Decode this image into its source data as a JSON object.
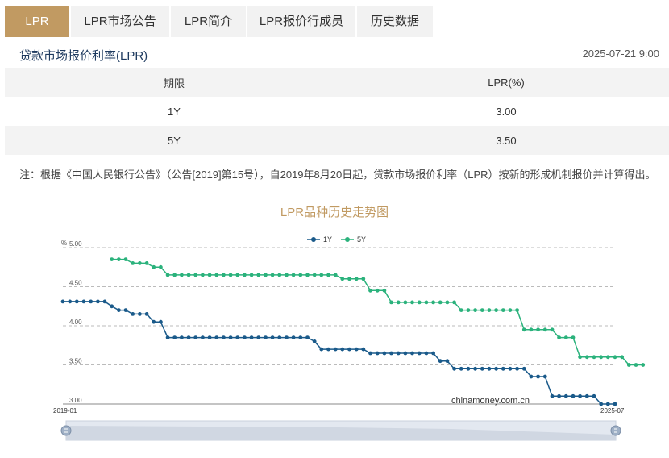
{
  "tabs": [
    "LPR",
    "LPR市场公告",
    "LPR简介",
    "LPR报价行成员",
    "历史数据"
  ],
  "section": {
    "title": "贷款市场报价利率(LPR)",
    "datetime": "2025-07-21 9:00"
  },
  "table": {
    "headers": [
      "期限",
      "LPR(%)"
    ],
    "rows": [
      {
        "term": "1Y",
        "rate": "3.00"
      },
      {
        "term": "5Y",
        "rate": "3.50"
      }
    ]
  },
  "note": "注：根据《中国人民银行公告》（公告[2019]第15号），自2019年8月20日起，贷款市场报价利率（LPR）按新的形成机制报价并计算得出。",
  "colors": {
    "accent": "#c19a62",
    "series_1y": "#1a5a8a",
    "series_5y": "#2bb27c"
  },
  "chart_data": {
    "type": "line",
    "title": "LPR品种历史走势图",
    "ylabel": "%",
    "ylim": [
      3.0,
      5.0
    ],
    "yticks": [
      "5.00",
      "4.50",
      "4.00",
      "3.50",
      "3.00"
    ],
    "x_range": [
      "2019-01",
      "2025-07"
    ],
    "legend": "top-center",
    "grid": true,
    "watermark": "chinamoney.com.cn",
    "series": [
      {
        "name": "1Y",
        "start_index": 0,
        "values": [
          4.31,
          4.31,
          4.31,
          4.31,
          4.31,
          4.31,
          4.31,
          4.25,
          4.2,
          4.2,
          4.15,
          4.15,
          4.15,
          4.05,
          4.05,
          3.85,
          3.85,
          3.85,
          3.85,
          3.85,
          3.85,
          3.85,
          3.85,
          3.85,
          3.85,
          3.85,
          3.85,
          3.85,
          3.85,
          3.85,
          3.85,
          3.85,
          3.85,
          3.85,
          3.85,
          3.85,
          3.8,
          3.7,
          3.7,
          3.7,
          3.7,
          3.7,
          3.7,
          3.7,
          3.65,
          3.65,
          3.65,
          3.65,
          3.65,
          3.65,
          3.65,
          3.65,
          3.65,
          3.65,
          3.55,
          3.55,
          3.45,
          3.45,
          3.45,
          3.45,
          3.45,
          3.45,
          3.45,
          3.45,
          3.45,
          3.45,
          3.45,
          3.35,
          3.35,
          3.35,
          3.1,
          3.1,
          3.1,
          3.1,
          3.1,
          3.1,
          3.1,
          3.0,
          3.0,
          3.0
        ]
      },
      {
        "name": "5Y",
        "start_index": 7,
        "values": [
          4.85,
          4.85,
          4.85,
          4.8,
          4.8,
          4.8,
          4.75,
          4.75,
          4.65,
          4.65,
          4.65,
          4.65,
          4.65,
          4.65,
          4.65,
          4.65,
          4.65,
          4.65,
          4.65,
          4.65,
          4.65,
          4.65,
          4.65,
          4.65,
          4.65,
          4.65,
          4.65,
          4.65,
          4.65,
          4.65,
          4.65,
          4.65,
          4.65,
          4.6,
          4.6,
          4.6,
          4.6,
          4.45,
          4.45,
          4.45,
          4.3,
          4.3,
          4.3,
          4.3,
          4.3,
          4.3,
          4.3,
          4.3,
          4.3,
          4.3,
          4.2,
          4.2,
          4.2,
          4.2,
          4.2,
          4.2,
          4.2,
          4.2,
          4.2,
          3.95,
          3.95,
          3.95,
          3.95,
          3.95,
          3.85,
          3.85,
          3.85,
          3.6,
          3.6,
          3.6,
          3.6,
          3.6,
          3.6,
          3.6,
          3.5,
          3.5,
          3.5
        ]
      }
    ]
  }
}
